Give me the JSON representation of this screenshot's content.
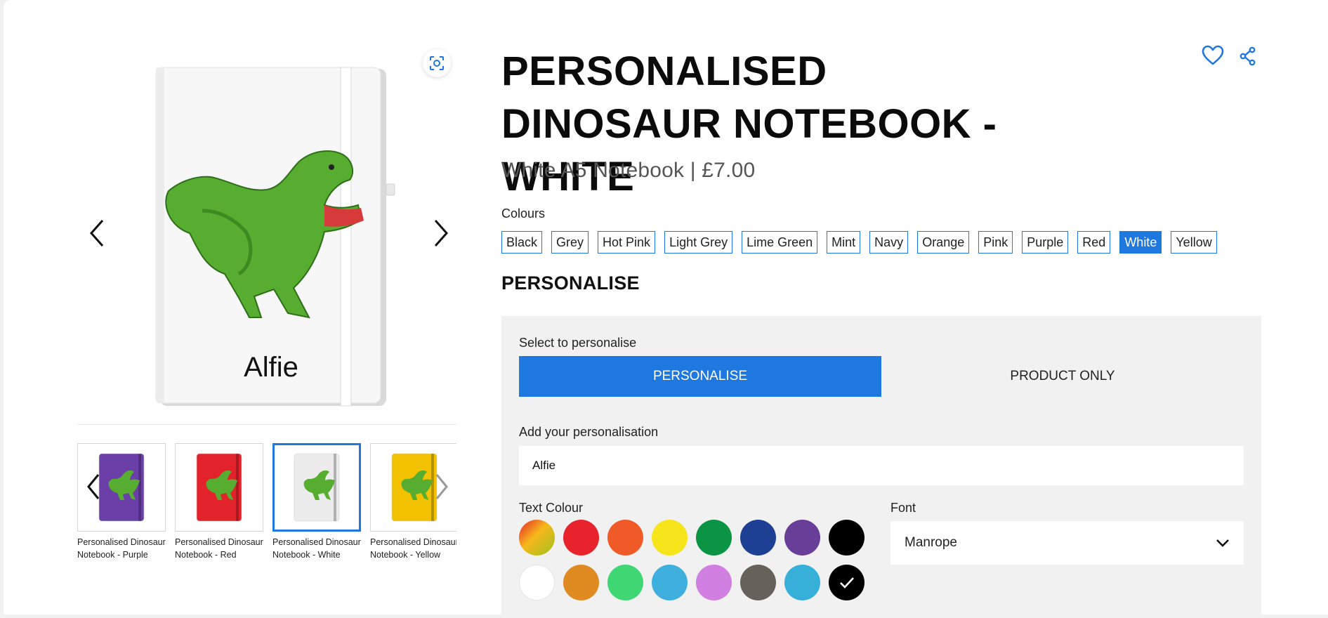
{
  "product": {
    "title": "PERSONALISED DINOSAUR NOTEBOOK - WHITE",
    "subtitle": "White A5 Notebook | £7.00",
    "preview_name": "Alfie"
  },
  "colours": {
    "label": "Colours",
    "options": [
      "Black",
      "Grey",
      "Hot Pink",
      "Light Grey",
      "Lime Green",
      "Mint",
      "Navy",
      "Orange",
      "Pink",
      "Purple",
      "Red",
      "White",
      "Yellow"
    ],
    "selected": "White"
  },
  "thumbnails": [
    {
      "caption": "Personalised Dinosaur Notebook - Purple",
      "color": "#6b3fa8"
    },
    {
      "caption": "Personalised Dinosaur Notebook - Red",
      "color": "#e3232b"
    },
    {
      "caption": "Personalised Dinosaur Notebook - White",
      "color": "#ececec"
    },
    {
      "caption": "Personalised Dinosaur Notebook - Yellow",
      "color": "#f2c200"
    }
  ],
  "personalise": {
    "heading": "PERSONALISE",
    "select_label": "Select to personalise",
    "option_personalise": "PERSONALISE",
    "option_product_only": "PRODUCT ONLY",
    "add_label": "Add your personalisation",
    "input_value": "Alfie",
    "text_colour_label": "Text Colour",
    "font_label": "Font",
    "font_value": "Manrope"
  },
  "text_colours": [
    "gradient",
    "#e8232b",
    "#f05a28",
    "#f7e51b",
    "#0a9444",
    "#1d3f94",
    "#673f98",
    "#000000",
    "#ffffff",
    "#e08a22",
    "#3fd674",
    "#3fb0de",
    "#d17fe0",
    "#67615b",
    "#36b0d9",
    "#000000"
  ],
  "selected_text_colour_index": 15,
  "accent_color": "#1f77e0"
}
